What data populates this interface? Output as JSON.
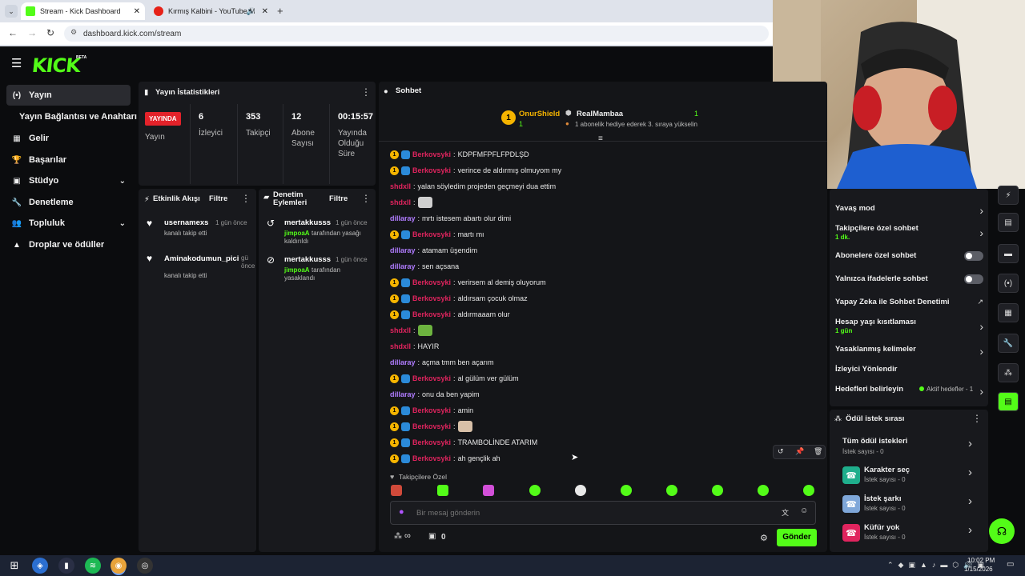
{
  "browser": {
    "tabs": [
      {
        "label": "Stream - Kick Dashboard",
        "active": true
      },
      {
        "label": "Kırmış Kalbini - YouTube M",
        "active": false
      }
    ],
    "url": "dashboard.kick.com/stream"
  },
  "brand": {
    "logo_text": "KICK",
    "logo_badge": "BETA",
    "accent": "#53fc18",
    "live_red": "#e3222a"
  },
  "sidebar": {
    "items": [
      {
        "label": "Yayın",
        "icon": "broadcast-icon",
        "active": true
      },
      {
        "label": "Yayın Bağlantısı ve Anahtarı",
        "icon": "",
        "active": false
      },
      {
        "label": "Gelir",
        "icon": "revenue-icon",
        "active": false
      },
      {
        "label": "Başarılar",
        "icon": "trophy-icon",
        "active": false
      },
      {
        "label": "Stüdyo",
        "icon": "studio-icon",
        "active": false,
        "expandable": true
      },
      {
        "label": "Denetleme",
        "icon": "wrench-icon",
        "active": false
      },
      {
        "label": "Topluluk",
        "icon": "community-icon",
        "active": false,
        "expandable": true
      },
      {
        "label": "Droplar ve ödüller",
        "icon": "gift-icon",
        "active": false
      }
    ]
  },
  "stats": {
    "title": "Yayın İstatistikleri",
    "live_badge": "YAYINDA",
    "cells": [
      {
        "value": "",
        "label": "Yayın"
      },
      {
        "value": "6",
        "label": "İzleyici"
      },
      {
        "value": "353",
        "label": "Takipçi"
      },
      {
        "value": "12",
        "label": "Abone Sayısı"
      },
      {
        "value": "00:15:57",
        "label": "Yayında Olduğu Süre"
      }
    ]
  },
  "activity": {
    "title": "Etkinlik Akışı",
    "filter": "Filtre",
    "items": [
      {
        "user": "usernamexs",
        "time": "1 gün önce",
        "text": "kanalı takip etti"
      },
      {
        "user": "Aminakodumun_pici",
        "time": "gü önce",
        "text": "kanalı takip etti"
      }
    ]
  },
  "moderation": {
    "title": "Denetim Eylemleri",
    "filter": "Filtre",
    "items": [
      {
        "user": "mertakkusss",
        "time": "1 gün önce",
        "actor": "jimpoaA",
        "text": "tarafından yasağı kaldırıldı",
        "icon": "undo-icon"
      },
      {
        "user": "mertakkusss",
        "time": "1 gün önce",
        "actor": "jimpoaA",
        "text": "tarafından yasaklandı",
        "icon": "ban-icon"
      }
    ]
  },
  "chat": {
    "title": "Sohbet",
    "leaderboard": {
      "first_name": "OnurShield",
      "first_count": "1",
      "second_name": "RealMambaa",
      "second_count": "1",
      "promo": "1 abonelik hediye ederek 3. sıraya yükselin"
    },
    "messages": [
      {
        "user": "Berkovsyki",
        "color": "#e0245e",
        "badges": true,
        "text": "KDPFMFPFLFPDLŞD"
      },
      {
        "user": "Berkovsyki",
        "color": "#e0245e",
        "badges": true,
        "text": "verince de aldırmış olmuyom my"
      },
      {
        "user": "shdxll",
        "color": "#e0245e",
        "badges": false,
        "text": "yalan söyledim projeden geçmeyi dua ettim"
      },
      {
        "user": "shdxll",
        "color": "#e0245e",
        "badges": false,
        "text": "",
        "emote": "cat-emote"
      },
      {
        "user": "dillaray",
        "color": "#b07cff",
        "badges": false,
        "text": "mrtı istesem abartı olur dimi"
      },
      {
        "user": "Berkovsyki",
        "color": "#e0245e",
        "badges": true,
        "text": "martı mı"
      },
      {
        "user": "dillaray",
        "color": "#b07cff",
        "badges": false,
        "text": "atamam üşendim"
      },
      {
        "user": "dillaray",
        "color": "#b07cff",
        "badges": false,
        "text": "sen açsana"
      },
      {
        "user": "Berkovsyki",
        "color": "#e0245e",
        "badges": true,
        "text": "verirsem al demiş oluyorum"
      },
      {
        "user": "Berkovsyki",
        "color": "#e0245e",
        "badges": true,
        "text": "aldırsam çocuk olmaz"
      },
      {
        "user": "Berkovsyki",
        "color": "#e0245e",
        "badges": true,
        "text": "aldırmaaam olur"
      },
      {
        "user": "shdxll",
        "color": "#e0245e",
        "badges": false,
        "text": "",
        "emote": "frog-emote"
      },
      {
        "user": "shdxll",
        "color": "#e0245e",
        "badges": false,
        "text": "HAYIR"
      },
      {
        "user": "dillaray",
        "color": "#b07cff",
        "badges": false,
        "text": "açma tmm ben açarım"
      },
      {
        "user": "Berkovsyki",
        "color": "#e0245e",
        "badges": true,
        "text": "al gülüm ver gülüm"
      },
      {
        "user": "dillaray",
        "color": "#b07cff",
        "badges": false,
        "text": "onu da ben yapim"
      },
      {
        "user": "Berkovsyki",
        "color": "#e0245e",
        "badges": true,
        "text": "amin"
      },
      {
        "user": "Berkovsyki",
        "color": "#e0245e",
        "badges": true,
        "text": "",
        "emote": "face-emote"
      },
      {
        "user": "Berkovsyki",
        "color": "#e0245e",
        "badges": true,
        "text": "TRAMBOLİNDE ATARIM"
      },
      {
        "user": "Berkovsyki",
        "color": "#e0245e",
        "badges": true,
        "text": "ah gençlik ah"
      }
    ],
    "followers_only_label": "Takipçilere Özel",
    "input_placeholder": "Bir mesaj gönderin",
    "points": "∞",
    "gifts": "0",
    "send_label": "Gönder"
  },
  "chat_settings": {
    "rows": [
      {
        "label": "Yavaş mod",
        "sub": "",
        "control": "chevron"
      },
      {
        "label": "Takipçilere özel sohbet",
        "sub": "1 dk.",
        "control": "chevron"
      },
      {
        "label": "Abonelere özel sohbet",
        "sub": "",
        "control": "toggle"
      },
      {
        "label": "Yalnızca ifadelerle sohbet",
        "sub": "",
        "control": "toggle"
      },
      {
        "label": "Yapay Zeka ile Sohbet Denetimi",
        "sub": "",
        "control": "external"
      },
      {
        "label": "Hesap yaşı kısıtlaması",
        "sub": "1 gün",
        "control": "chevron"
      },
      {
        "label": "Yasaklanmış kelimeler",
        "sub": "",
        "control": "chevron"
      },
      {
        "label": "İzleyici Yönlendir",
        "sub": "",
        "control": "none"
      },
      {
        "label": "Hedefleri belirleyin",
        "sub": "",
        "control": "chevron",
        "extra": "Aktif hedefler - 1"
      }
    ]
  },
  "rewards": {
    "title": "Ödül istek sırası",
    "items": [
      {
        "title": "Tüm ödül istekleri",
        "sub": "İstek sayısı - 0",
        "color": "",
        "icon": ""
      },
      {
        "title": "Karakter seç",
        "sub": "İstek sayısı - 0",
        "color": "#1fae8c",
        "icon": "character-icon"
      },
      {
        "title": "İstek şarkı",
        "sub": "İstek sayısı - 0",
        "color": "#7fa7d9",
        "icon": "song-icon"
      },
      {
        "title": "Küfür yok",
        "sub": "İstek sayısı - 0",
        "color": "#e0245e",
        "icon": "no-swear-icon"
      }
    ]
  },
  "taskbar": {
    "time": "10:02 PM",
    "date": "1/15/2026"
  }
}
